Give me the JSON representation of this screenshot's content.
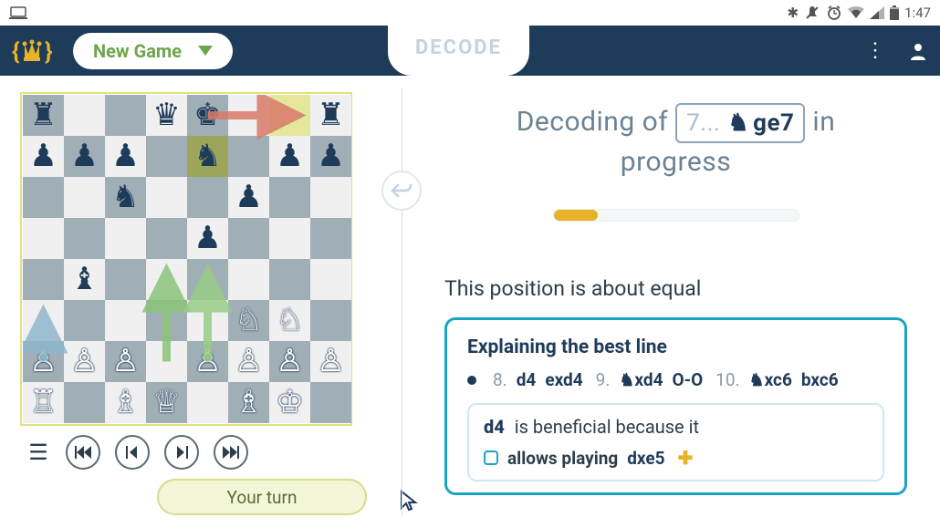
{
  "status": {
    "time": "1:47"
  },
  "header": {
    "new_game": "New Game",
    "decode": "DECODE"
  },
  "turn_label": "Your turn",
  "decoding": {
    "prefix": "Decoding of",
    "move_num": "7...",
    "move_piece": "knight",
    "move_san": "ge7",
    "suffix1": "in",
    "suffix2": "progress",
    "progress_pct": 18
  },
  "eval_text": "This position is about equal",
  "best_line": {
    "title": "Explaining the best line",
    "moves": [
      {
        "num": "8.",
        "w": "d4",
        "b": "exd4"
      },
      {
        "num": "9.",
        "w_piece": "knight",
        "w": "xd4",
        "b": "O-O"
      },
      {
        "num": "10.",
        "w_piece": "knight",
        "w": "xc6",
        "b": "bxc6"
      }
    ],
    "benefit_move": "d4",
    "benefit_text": "is beneficial because it",
    "allows_label": "allows playing",
    "allows_move": "dxe5"
  },
  "board": {
    "highlight_from": "g8",
    "highlight_to": "e7",
    "position": {
      "a8": "br",
      "d8": "bq",
      "e8": "bk",
      "h8": "br",
      "a7": "bp",
      "b7": "bp",
      "c7": "bp",
      "e7": "bn",
      "g7": "bp",
      "h7": "bp",
      "c6": "bn",
      "f6": "bp",
      "e5": "bp",
      "b4": "bb",
      "f3": "wn",
      "g3": "wn",
      "a2": "wp",
      "b2": "wp",
      "c2": "wp",
      "e2": "wp",
      "f2": "wp",
      "g2": "wp",
      "h2": "wp",
      "a1": "wr",
      "c1": "wb",
      "d1": "wq",
      "f1": "wb",
      "g1": "wk"
    },
    "arrows": [
      {
        "from": "e8",
        "to": "g8",
        "color": "#d97a6a"
      },
      {
        "from": "d2",
        "to": "d4",
        "color": "#8bc47a"
      },
      {
        "from": "e2",
        "to": "e4",
        "color": "#9acc88"
      },
      {
        "from": "a2",
        "to": "a3",
        "color": "#8fb7cc"
      }
    ]
  }
}
